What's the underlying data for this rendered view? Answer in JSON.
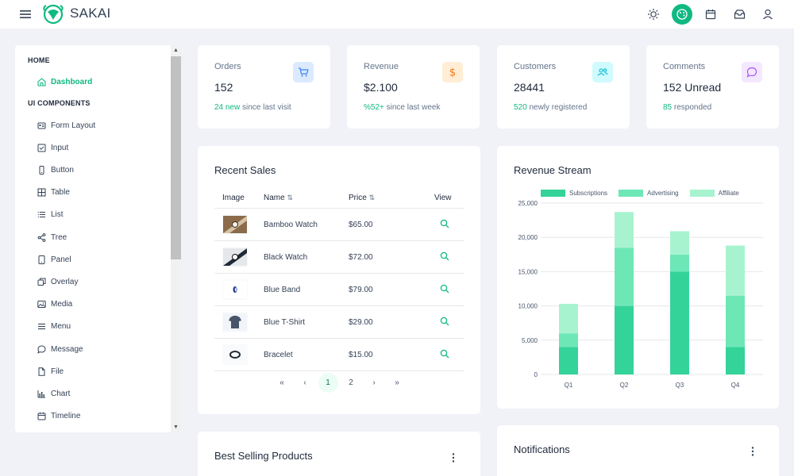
{
  "app": {
    "brand": "SAKAI"
  },
  "sidebar": {
    "sections": [
      {
        "label": "HOME"
      },
      {
        "label": "UI COMPONENTS"
      }
    ],
    "home_items": [
      {
        "label": "Dashboard",
        "icon": "home-icon",
        "active": true
      }
    ],
    "ui_items": [
      {
        "label": "Form Layout",
        "icon": "id-card-icon"
      },
      {
        "label": "Input",
        "icon": "check-square-icon"
      },
      {
        "label": "Button",
        "icon": "mobile-icon"
      },
      {
        "label": "Table",
        "icon": "table-icon"
      },
      {
        "label": "List",
        "icon": "list-icon"
      },
      {
        "label": "Tree",
        "icon": "share-icon"
      },
      {
        "label": "Panel",
        "icon": "tablet-icon"
      },
      {
        "label": "Overlay",
        "icon": "clone-icon"
      },
      {
        "label": "Media",
        "icon": "image-icon"
      },
      {
        "label": "Menu",
        "icon": "bars-icon"
      },
      {
        "label": "Message",
        "icon": "comment-icon"
      },
      {
        "label": "File",
        "icon": "file-icon"
      },
      {
        "label": "Chart",
        "icon": "chart-bar-icon"
      },
      {
        "label": "Timeline",
        "icon": "calendar-icon"
      }
    ]
  },
  "stats": [
    {
      "title": "Orders",
      "value": "152",
      "highlight": "24 new",
      "foot": " since last visit",
      "icon": "cart-icon",
      "icon_bg": "#dbeafe",
      "icon_color": "#3b82f6"
    },
    {
      "title": "Revenue",
      "value": "$2.100",
      "highlight": "%52+",
      "foot": " since last week",
      "icon": "dollar-icon",
      "icon_bg": "#ffedd5",
      "icon_color": "#f97316"
    },
    {
      "title": "Customers",
      "value": "28441",
      "highlight": "520",
      "foot": " newly registered",
      "icon": "users-icon",
      "icon_bg": "#cffafe",
      "icon_color": "#06b6d4"
    },
    {
      "title": "Comments",
      "value": "152 Unread",
      "highlight": "85",
      "foot": " responded",
      "icon": "comment-icon",
      "icon_bg": "#f3e8ff",
      "icon_color": "#a855f7"
    }
  ],
  "recent_sales": {
    "title": "Recent Sales",
    "columns": {
      "image": "Image",
      "name": "Name",
      "price": "Price",
      "view": "View"
    },
    "rows": [
      {
        "name": "Bamboo Watch",
        "price": "$65.00"
      },
      {
        "name": "Black Watch",
        "price": "$72.00"
      },
      {
        "name": "Blue Band",
        "price": "$79.00"
      },
      {
        "name": "Blue T-Shirt",
        "price": "$29.00"
      },
      {
        "name": "Bracelet",
        "price": "$15.00"
      }
    ],
    "pager": {
      "first": "«",
      "prev": "‹",
      "pages": [
        "1",
        "2"
      ],
      "current": "1",
      "next": "›",
      "last": "»"
    }
  },
  "revenue_stream": {
    "title": "Revenue Stream"
  },
  "best_selling": {
    "title": "Best Selling Products"
  },
  "notifications": {
    "title": "Notifications"
  },
  "colors": {
    "accent": "#10b981",
    "subscriptions": "#34d399",
    "advertising": "#6ee7b7",
    "affiliate": "#a7f3d0"
  },
  "chart_data": {
    "type": "bar",
    "stacked": true,
    "categories": [
      "Q1",
      "Q2",
      "Q3",
      "Q4"
    ],
    "series": [
      {
        "name": "Subscriptions",
        "values": [
          4000,
          10000,
          15000,
          4000
        ]
      },
      {
        "name": "Advertising",
        "values": [
          2000,
          8500,
          2500,
          7500
        ]
      },
      {
        "name": "Affiliate",
        "values": [
          4300,
          5200,
          3400,
          7300
        ]
      }
    ],
    "yticks": [
      "0",
      "5,000",
      "10,000",
      "15,000",
      "20,000",
      "25,000"
    ],
    "ylim": [
      0,
      25000
    ],
    "legend": "top",
    "grid": true
  }
}
